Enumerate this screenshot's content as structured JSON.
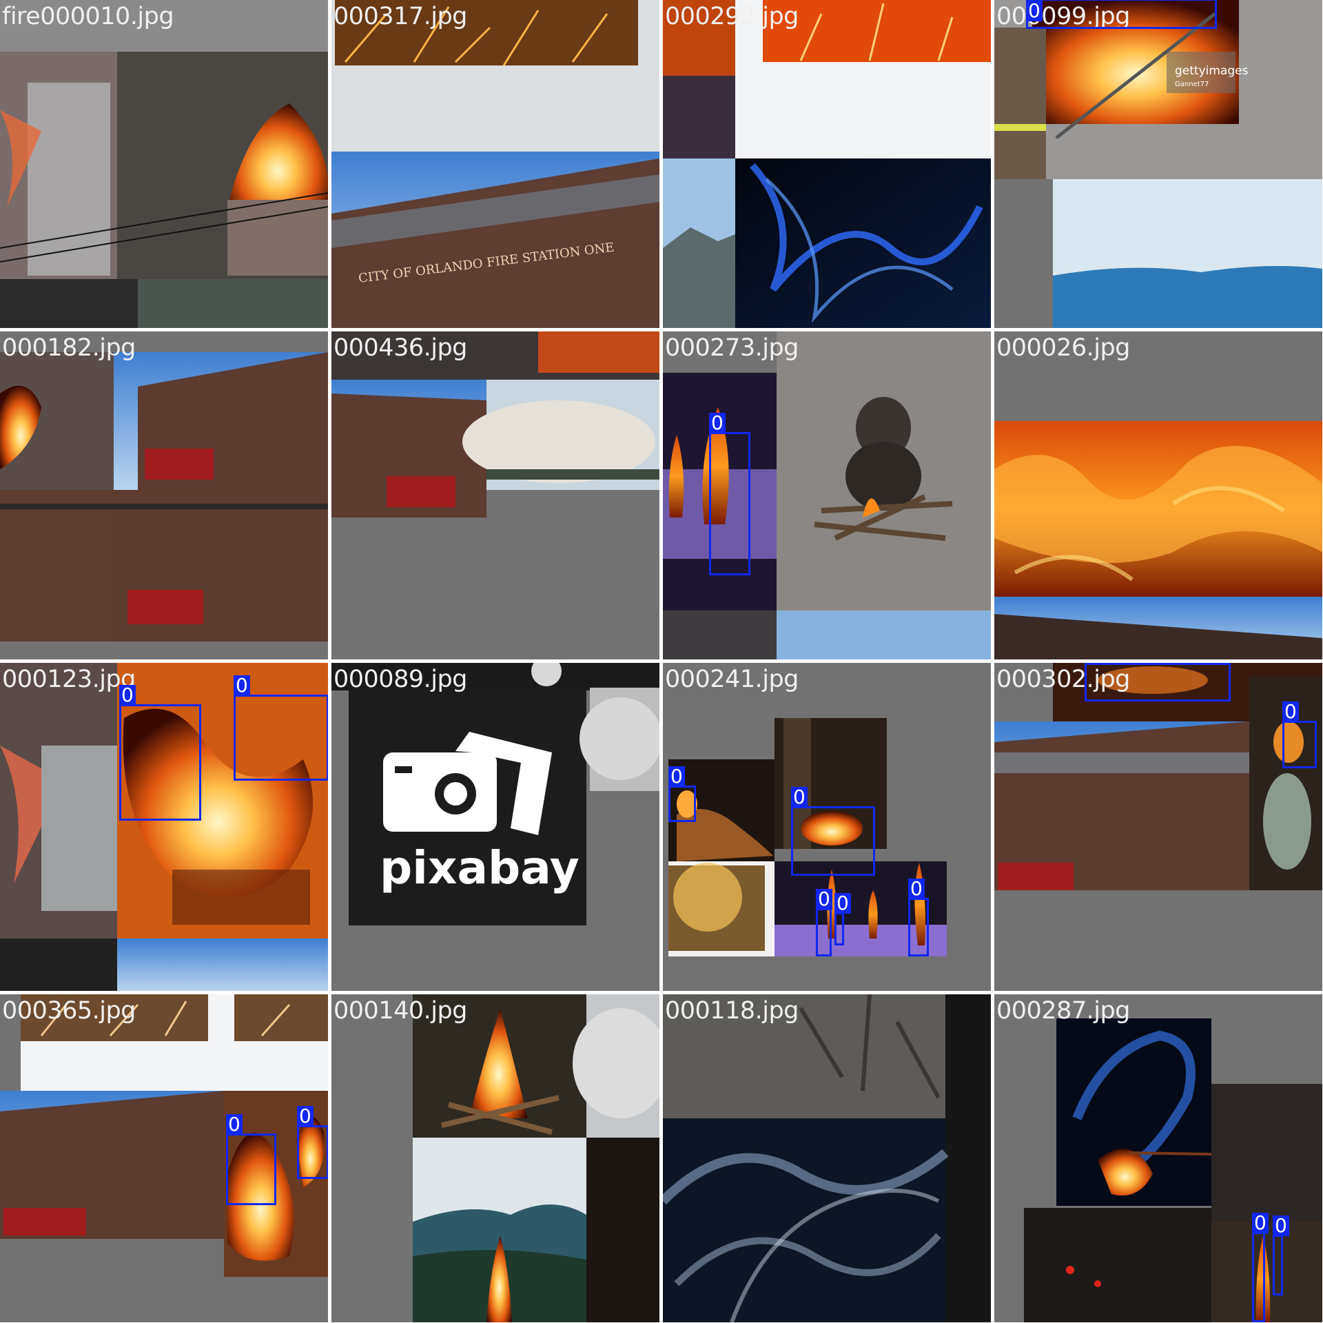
{
  "tiles": [
    {
      "filename": "fire000010.jpg",
      "detections": []
    },
    {
      "filename": "000317.jpg",
      "detections": []
    },
    {
      "filename": "000292.jpg",
      "detections": []
    },
    {
      "filename": "000099.jpg",
      "detections": [
        {
          "class": "0"
        }
      ]
    },
    {
      "filename": "000182.jpg",
      "detections": []
    },
    {
      "filename": "000436.jpg",
      "detections": []
    },
    {
      "filename": "000273.jpg",
      "detections": [
        {
          "class": "0"
        }
      ]
    },
    {
      "filename": "000026.jpg",
      "detections": []
    },
    {
      "filename": "000123.jpg",
      "detections": [
        {
          "class": "0"
        },
        {
          "class": "0"
        }
      ]
    },
    {
      "filename": "000089.jpg",
      "detections": []
    },
    {
      "filename": "000241.jpg",
      "detections": [
        {
          "class": "0"
        },
        {
          "class": "0"
        },
        {
          "class": "0"
        },
        {
          "class": "0"
        },
        {
          "class": "0"
        }
      ]
    },
    {
      "filename": "000302.jpg",
      "detections": [
        {
          "class": "0"
        },
        {
          "class": "0"
        }
      ]
    },
    {
      "filename": "000365.jpg",
      "detections": [
        {
          "class": "0"
        },
        {
          "class": "0"
        }
      ]
    },
    {
      "filename": "000140.jpg",
      "detections": []
    },
    {
      "filename": "000118.jpg",
      "detections": []
    },
    {
      "filename": "000287.jpg",
      "detections": [
        {
          "class": "0"
        },
        {
          "class": "0"
        }
      ]
    }
  ],
  "colors": {
    "box": "#1227f0",
    "label_text": "#ffffff",
    "filename_text": "#f0f0f0",
    "pad": "#727272"
  },
  "overlay_text": {
    "gettyimages": "gettyimages",
    "getty_sub": "Gannet77",
    "pixabay": "pixabay",
    "station": "CITY OF ORLANDO FIRE STATION ONE"
  }
}
